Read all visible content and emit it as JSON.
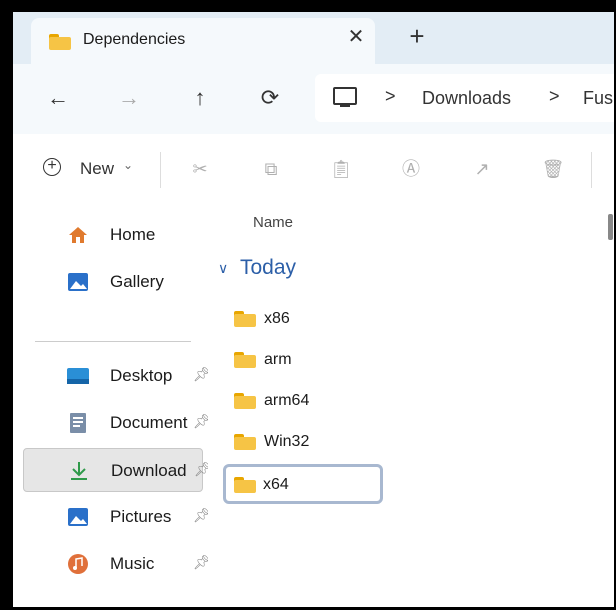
{
  "tab": {
    "title": "Dependencies",
    "close": "✕",
    "new_tab": "+"
  },
  "nav": {
    "back": "←",
    "forward": "→",
    "up": "↑",
    "refresh": "⟳",
    "breadcrumbs": [
      "Downloads",
      "Fus"
    ],
    "separator": ">"
  },
  "toolbar": {
    "new_label": "New",
    "icons": [
      "cut-icon",
      "copy-icon",
      "paste-icon",
      "rename-icon",
      "share-icon",
      "delete-icon"
    ]
  },
  "sidebar": {
    "items": [
      {
        "label": "Home",
        "icon": "home-icon"
      },
      {
        "label": "Gallery",
        "icon": "gallery-icon"
      },
      {
        "label": "Desktop",
        "icon": "desktop-icon",
        "pinned": true
      },
      {
        "label": "Document",
        "icon": "documents-icon",
        "pinned": true
      },
      {
        "label": "Download",
        "icon": "download-icon",
        "pinned": true,
        "selected": true
      },
      {
        "label": "Pictures",
        "icon": "pictures-icon",
        "pinned": true
      },
      {
        "label": "Music",
        "icon": "music-icon",
        "pinned": true
      }
    ]
  },
  "content": {
    "column_name": "Name",
    "group": "Today",
    "files": [
      "x86",
      "arm",
      "arm64",
      "Win32",
      "x64"
    ],
    "selected_file": "x64"
  },
  "colors": {
    "accent": "#2c5fa8",
    "folder": "#f6c445",
    "titlebar": "#e3edf5"
  }
}
